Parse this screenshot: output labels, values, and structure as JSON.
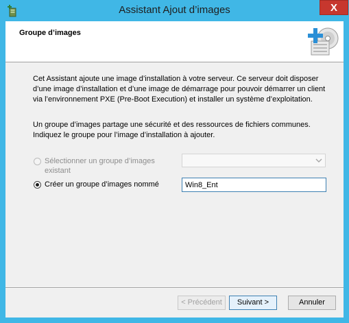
{
  "window": {
    "title": "Assistant Ajout d’images",
    "close_label": "X"
  },
  "header": {
    "title": "Groupe d’images"
  },
  "content": {
    "intro": "Cet Assistant ajoute une image d’installation à votre serveur. Ce serveur doit disposer d’une image d’installation et d’une image de démarrage pour pouvoir démarrer un client via l’environnement PXE (Pre-Boot Execution) et installer un système d’exploitation.",
    "group_info": "Un groupe d’images partage une sécurité et des ressources de fichiers communes. Indiquez le groupe pour l’image d’installation à ajouter.",
    "option_existing": {
      "label": "Sélectionner un groupe d’images existant",
      "selected": false,
      "enabled": false
    },
    "option_new": {
      "label": "Créer un groupe d’images nommé",
      "selected": true,
      "enabled": true
    },
    "existing_group_value": "",
    "new_group_name": "Win8_Ent"
  },
  "buttons": {
    "previous": "< Précédent",
    "next": "Suivant >",
    "cancel": "Annuler"
  },
  "colors": {
    "frame": "#40b7e6",
    "close": "#c7372e",
    "accent": "#3c7fb1"
  },
  "icons": {
    "app": "server-add-icon",
    "header": "add-image-disc-icon"
  }
}
